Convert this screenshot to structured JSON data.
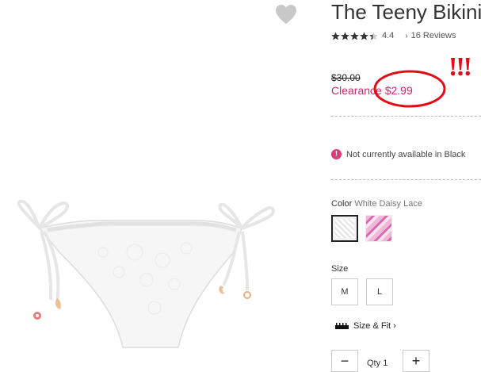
{
  "product": {
    "title": "The Teeny Bikini",
    "rating": 4.4,
    "rating_text": "4.4",
    "reviews_text": "16 Reviews",
    "original_price": "$30.00",
    "sale_price": "Clearance $2.99",
    "annotation": "!!!",
    "availability": "Not currently available in Black",
    "color_label": "Color",
    "color_value": "White Daisy Lace",
    "size_label": "Size",
    "sizes": [
      "M",
      "L"
    ],
    "size_fit": "Size & Fit",
    "qty_label": "Qty",
    "qty_value": "1",
    "minus": "−",
    "plus": "+"
  },
  "colors": {
    "sale": "#d3256b",
    "annotation": "#e30b14",
    "alert": "#e23a78"
  },
  "icons": [
    "heart-icon",
    "star-icon",
    "chevron-right-icon",
    "alert-icon",
    "ruler-icon"
  ]
}
